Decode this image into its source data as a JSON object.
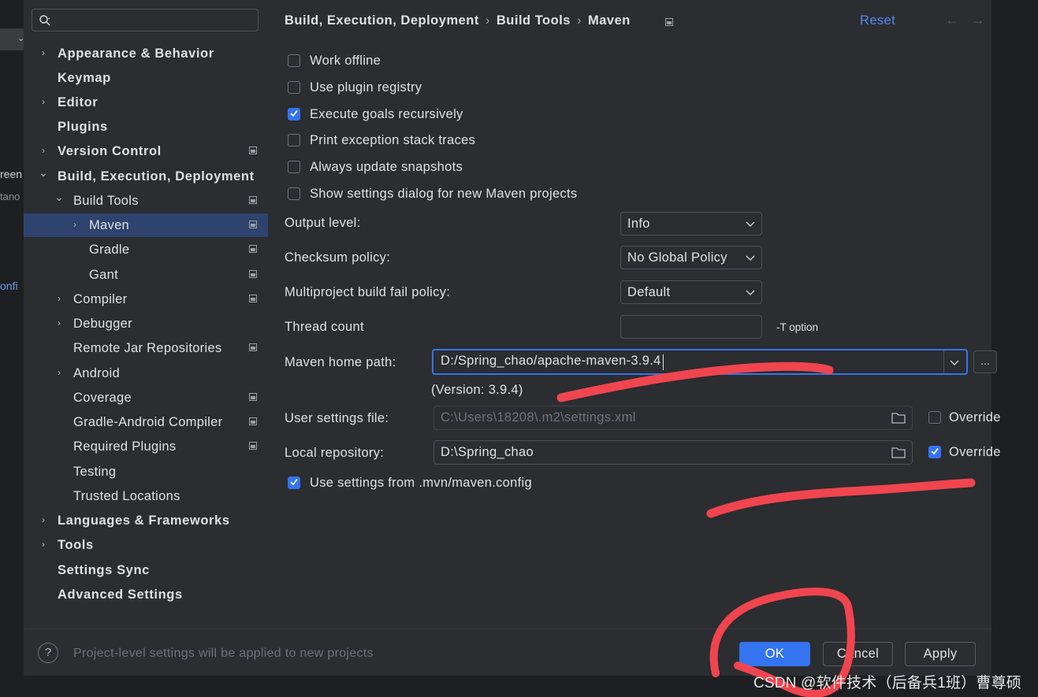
{
  "background_window": {
    "fragments": [
      "reen",
      "tano",
      "onfi"
    ]
  },
  "search": {
    "placeholder": ""
  },
  "sidebar": {
    "items": [
      {
        "label": "Appearance & Behavior",
        "expandable": true,
        "level": 0,
        "bold": true
      },
      {
        "label": "Keymap",
        "expandable": false,
        "level": 0,
        "bold": true
      },
      {
        "label": "Editor",
        "expandable": true,
        "level": 0,
        "bold": true
      },
      {
        "label": "Plugins",
        "expandable": false,
        "level": 0,
        "bold": true
      },
      {
        "label": "Version Control",
        "expandable": true,
        "level": 0,
        "bold": true,
        "project_icon": true
      },
      {
        "label": "Build, Execution, Deployment",
        "expandable": true,
        "expanded": true,
        "level": 0,
        "bold": true
      },
      {
        "label": "Build Tools",
        "expandable": true,
        "expanded": true,
        "level": 1,
        "project_icon": true
      },
      {
        "label": "Maven",
        "expandable": true,
        "level": 2,
        "selected": true,
        "project_icon": true
      },
      {
        "label": "Gradle",
        "expandable": false,
        "level": 2,
        "project_icon": true
      },
      {
        "label": "Gant",
        "expandable": false,
        "level": 2,
        "project_icon": true
      },
      {
        "label": "Compiler",
        "expandable": true,
        "level": 1,
        "project_icon": true
      },
      {
        "label": "Debugger",
        "expandable": true,
        "level": 1
      },
      {
        "label": "Remote Jar Repositories",
        "expandable": false,
        "level": 1,
        "project_icon": true
      },
      {
        "label": "Android",
        "expandable": true,
        "level": 1
      },
      {
        "label": "Coverage",
        "expandable": false,
        "level": 1,
        "project_icon": true
      },
      {
        "label": "Gradle-Android Compiler",
        "expandable": false,
        "level": 1,
        "project_icon": true
      },
      {
        "label": "Required Plugins",
        "expandable": false,
        "level": 1,
        "project_icon": true
      },
      {
        "label": "Testing",
        "expandable": false,
        "level": 1
      },
      {
        "label": "Trusted Locations",
        "expandable": false,
        "level": 1
      },
      {
        "label": "Languages & Frameworks",
        "expandable": true,
        "level": 0,
        "bold": true
      },
      {
        "label": "Tools",
        "expandable": true,
        "level": 0,
        "bold": true
      },
      {
        "label": "Settings Sync",
        "expandable": false,
        "level": 0,
        "bold": true
      },
      {
        "label": "Advanced Settings",
        "expandable": false,
        "level": 0,
        "bold": true
      }
    ]
  },
  "breadcrumb": {
    "part1": "Build, Execution, Deployment",
    "part2": "Build Tools",
    "part3": "Maven",
    "separator": "›"
  },
  "header": {
    "reset_label": "Reset",
    "back_glyph": "←",
    "forward_glyph": "→"
  },
  "checkboxes": [
    {
      "label": "Work offline",
      "checked": false
    },
    {
      "label": "Use plugin registry",
      "checked": false
    },
    {
      "label": "Execute goals recursively",
      "checked": true
    },
    {
      "label": "Print exception stack traces",
      "checked": false
    },
    {
      "label": "Always update snapshots",
      "checked": false
    },
    {
      "label": "Show settings dialog for new Maven projects",
      "checked": false
    }
  ],
  "form": {
    "output_level": {
      "label": "Output level:",
      "value": "Info"
    },
    "checksum_policy": {
      "label": "Checksum policy:",
      "value": "No Global Policy"
    },
    "fail_policy": {
      "label": "Multiproject build fail policy:",
      "value": "Default"
    },
    "thread_count": {
      "label": "Thread count",
      "value": "",
      "hint": "-T option"
    },
    "maven_home": {
      "label": "Maven home path:",
      "value": "D:/Spring_chao/apache-maven-3.9.4",
      "browse": "...",
      "version": "(Version: 3.9.4)"
    },
    "user_settings": {
      "label": "User settings file:",
      "value": "C:\\Users\\18208\\.m2\\settings.xml",
      "override_label": "Override",
      "override": false
    },
    "local_repo": {
      "label": "Local repository:",
      "value": "D:\\Spring_chao",
      "override_label": "Override",
      "override": true
    },
    "use_mvn_config": {
      "label": "Use settings from .mvn/maven.config",
      "checked": true
    }
  },
  "footer": {
    "help_glyph": "?",
    "note": "Project-level settings will be applied to new projects",
    "ok_label": "OK",
    "cancel_label": "Cancel",
    "apply_label": "Apply"
  },
  "watermark": "CSDN @软件技术（后备兵1班）曹尊硕",
  "colors": {
    "accent": "#3574f0",
    "annotation": "#f0454f",
    "selection": "#2e436e",
    "link": "#548af7"
  }
}
